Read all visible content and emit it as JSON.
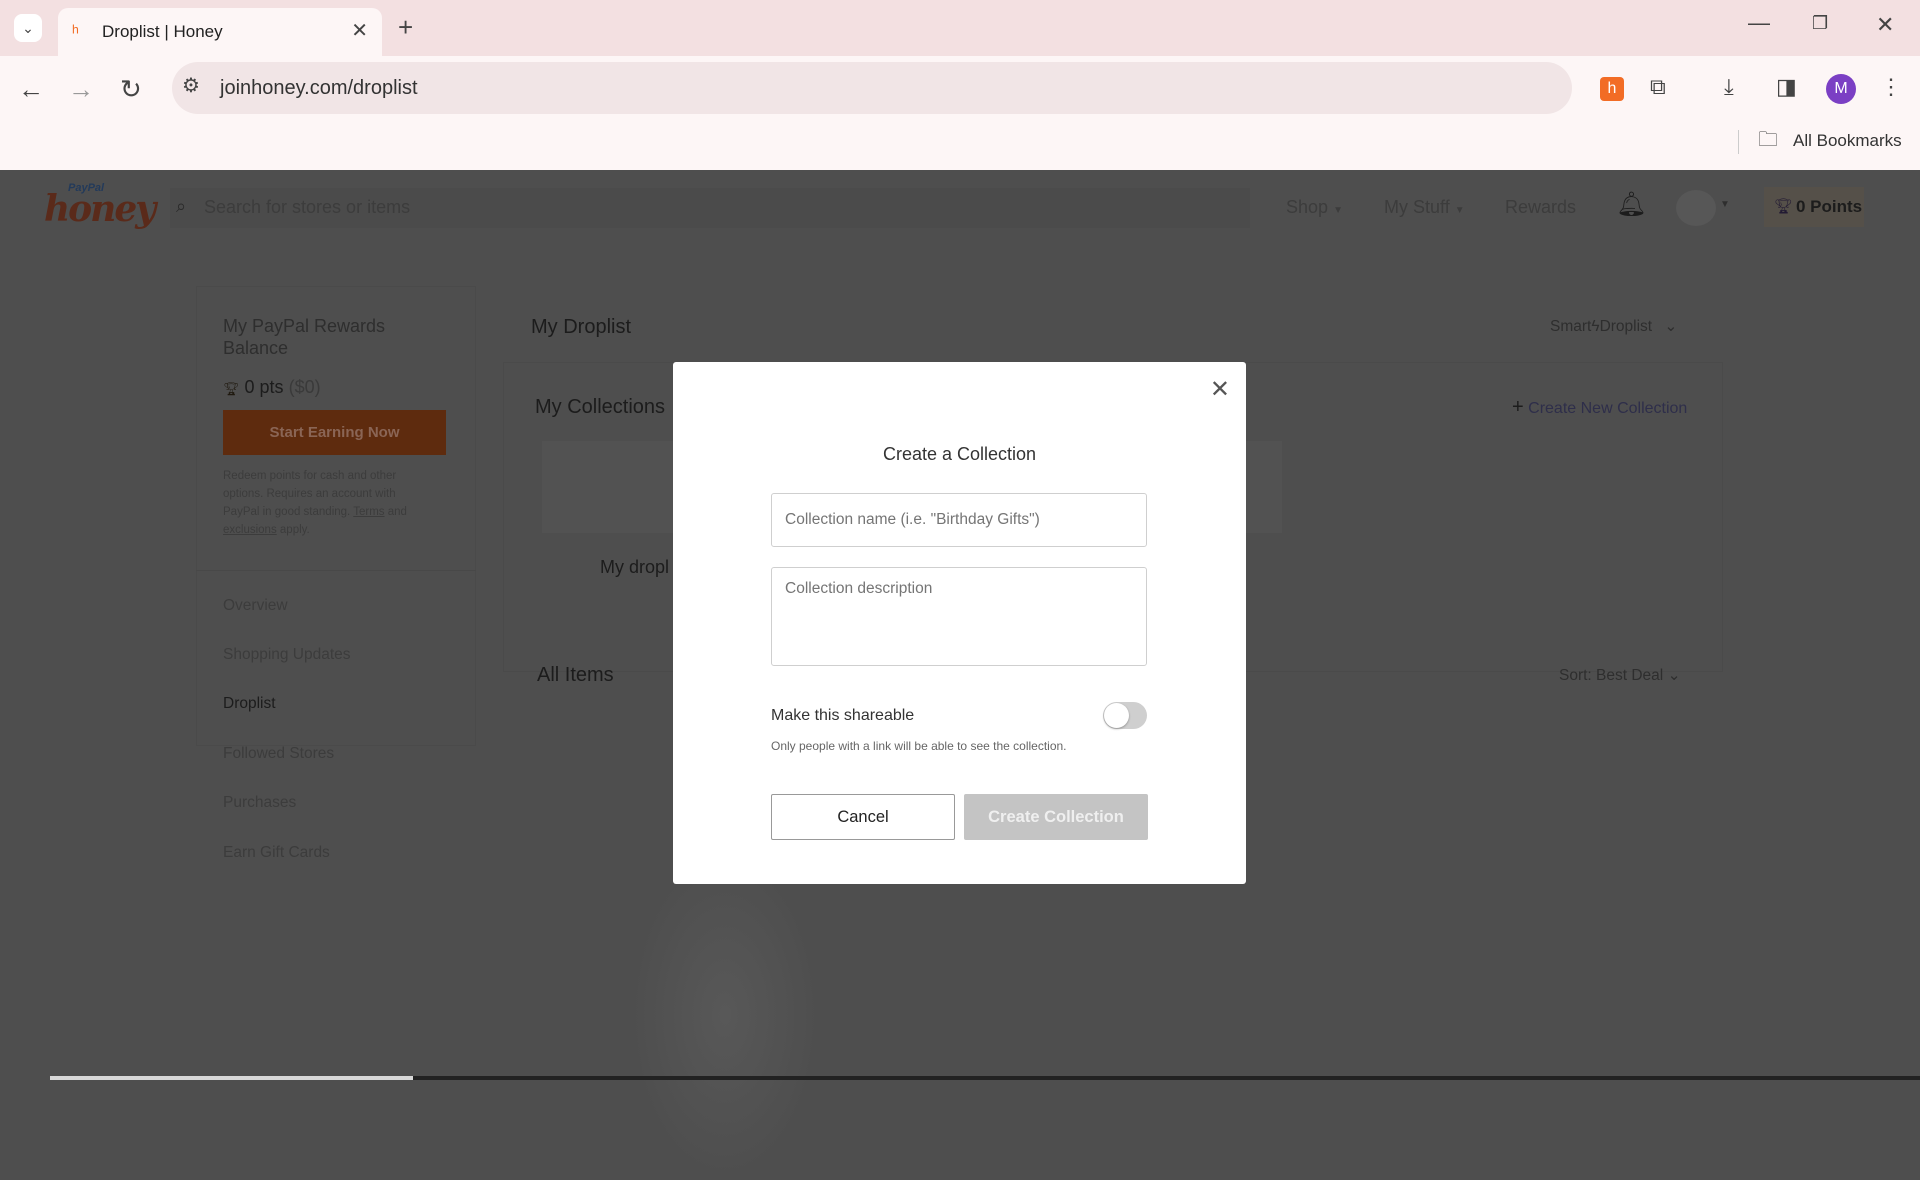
{
  "browser": {
    "tab_title": "Droplist | Honey",
    "url": "joinhoney.com/droplist",
    "bookmarks_label": "All Bookmarks",
    "profile_initial": "M"
  },
  "header": {
    "logo_text": "PayPal honey",
    "search_placeholder": "Search for stores or items",
    "nav": [
      "Shop",
      "My Stuff",
      "Rewards"
    ],
    "points": "0 Points"
  },
  "sidebar": {
    "balance_title": "My PayPal Rewards Balance",
    "pts": "0 pts",
    "pts_value": "($0)",
    "cta": "Start Earning Now",
    "fine_print": "Redeem points for cash and other options. Requires an account with PayPal in good standing.",
    "terms_link": "Terms",
    "and": "and",
    "exclusions_link": "exclusions",
    "apply": "apply.",
    "items": [
      {
        "label": "Overview"
      },
      {
        "label": "Shopping Updates"
      },
      {
        "label": "Droplist",
        "active": true
      },
      {
        "label": "Followed Stores"
      },
      {
        "label": "Purchases"
      },
      {
        "label": "Earn Gift Cards"
      }
    ]
  },
  "main": {
    "title": "My Droplist",
    "smart_droplist": "Smart",
    "smart_droplist_2": "Droplist",
    "collections_title": "My Collections",
    "create_new": "Create New Collection",
    "collection_name": "My dropl",
    "all_items": "All Items",
    "sort": "Sort: Best Deal"
  },
  "modal": {
    "title": "Create a Collection",
    "name_placeholder": "Collection name (i.e. \"Birthday Gifts\")",
    "description_placeholder": "Collection description",
    "shareable_label": "Make this shareable",
    "shareable_on": false,
    "shareable_help": "Only people with a link will be able to see the collection.",
    "cancel": "Cancel",
    "create": "Create Collection"
  },
  "colors": {
    "brand": "#f26c25",
    "overlay": "#4e4e4e",
    "disabled_button": "#c4c4c4"
  }
}
